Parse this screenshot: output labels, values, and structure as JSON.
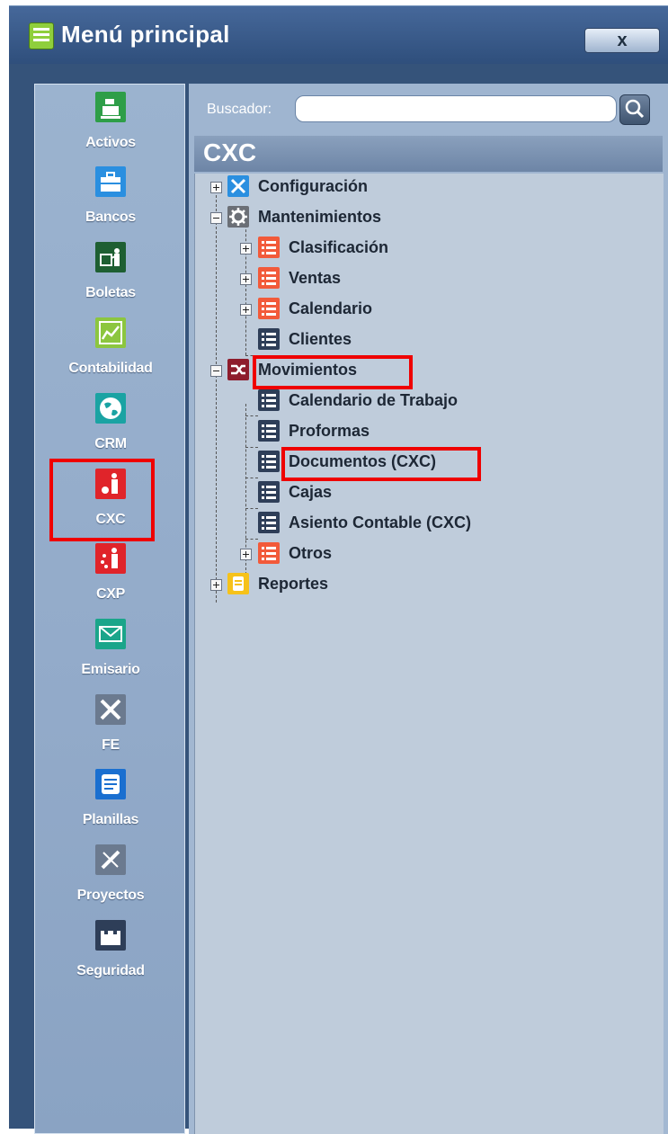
{
  "window": {
    "title": "Menú principal",
    "close_label": "x"
  },
  "sidebar": {
    "items": [
      {
        "label": "Activos",
        "icon": "cash-register-icon",
        "color": "#2e9e48"
      },
      {
        "label": "Bancos",
        "icon": "briefcase-icon",
        "color": "#2a8fe0"
      },
      {
        "label": "Boletas",
        "icon": "presentation-icon",
        "color": "#1e5f32"
      },
      {
        "label": "Contabilidad",
        "icon": "chart-icon",
        "color": "#8cc63f"
      },
      {
        "label": "CRM",
        "icon": "globe-icon",
        "color": "#1aa3a3"
      },
      {
        "label": "CXC",
        "icon": "person-money-icon",
        "color": "#e0242a"
      },
      {
        "label": "CXP",
        "icon": "person-coins-icon",
        "color": "#e0242a"
      },
      {
        "label": "Emisario",
        "icon": "envelope-icon",
        "color": "#1aa58a"
      },
      {
        "label": "FE",
        "icon": "tools-icon",
        "color": "#6b7a8f"
      },
      {
        "label": "Planillas",
        "icon": "document-icon",
        "color": "#1a6fd0"
      },
      {
        "label": "Proyectos",
        "icon": "pencil-ruler-icon",
        "color": "#6b7a8f"
      },
      {
        "label": "Seguridad",
        "icon": "castle-icon",
        "color": "#2e3e58"
      }
    ]
  },
  "search": {
    "label": "Buscador:",
    "value": "",
    "placeholder": ""
  },
  "section": {
    "title": "CXC"
  },
  "tree": [
    {
      "label": "Configuración",
      "icon": "wrench-icon"
    },
    {
      "label": "Mantenimientos",
      "icon": "gear-icon"
    },
    {
      "label": "Clasificación",
      "icon": "list-icon"
    },
    {
      "label": "Ventas",
      "icon": "list-icon"
    },
    {
      "label": "Calendario",
      "icon": "list-icon"
    },
    {
      "label": "Clientes",
      "icon": "list-icon"
    },
    {
      "label": "Movimientos",
      "icon": "shuffle-icon"
    },
    {
      "label": "Calendario de Trabajo",
      "icon": "list-icon"
    },
    {
      "label": "Proformas",
      "icon": "list-icon"
    },
    {
      "label": "Documentos (CXC)",
      "icon": "list-icon"
    },
    {
      "label": "Cajas",
      "icon": "list-icon"
    },
    {
      "label": "Asiento Contable (CXC)",
      "icon": "list-icon"
    },
    {
      "label": "Otros",
      "icon": "list-icon"
    },
    {
      "label": "Reportes",
      "icon": "notepad-icon"
    }
  ]
}
